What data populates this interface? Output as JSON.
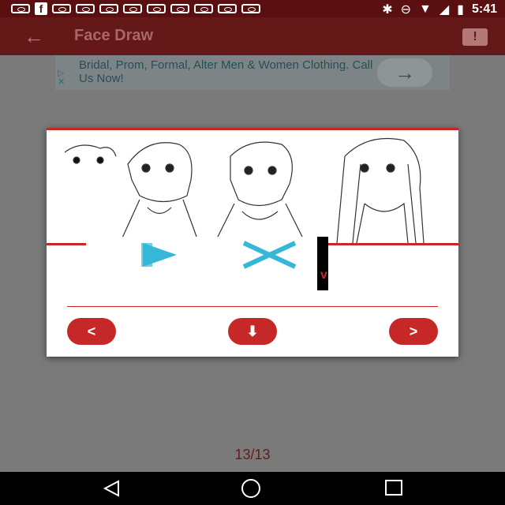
{
  "status_bar": {
    "time": "5:41",
    "notification_icon_count": 10
  },
  "app_bar": {
    "title": "Face Draw",
    "back_icon": "arrow-back-icon",
    "report_icon": "report-icon"
  },
  "ad_banner": {
    "text": "Bridal, Prom, Formal, Alter Men & Women Clothing. Call Us Now!",
    "arrow_icon": "arrow-right-icon"
  },
  "dialog": {
    "image_alt": "anime face drawing steps",
    "buttons": {
      "prev_label": "<",
      "download_icon": "download-icon",
      "next_label": ">"
    }
  },
  "pager": {
    "text": "13/13"
  },
  "colors": {
    "accent": "#c62828",
    "app_bar": "#641818",
    "status_bar": "#5a0f10"
  }
}
